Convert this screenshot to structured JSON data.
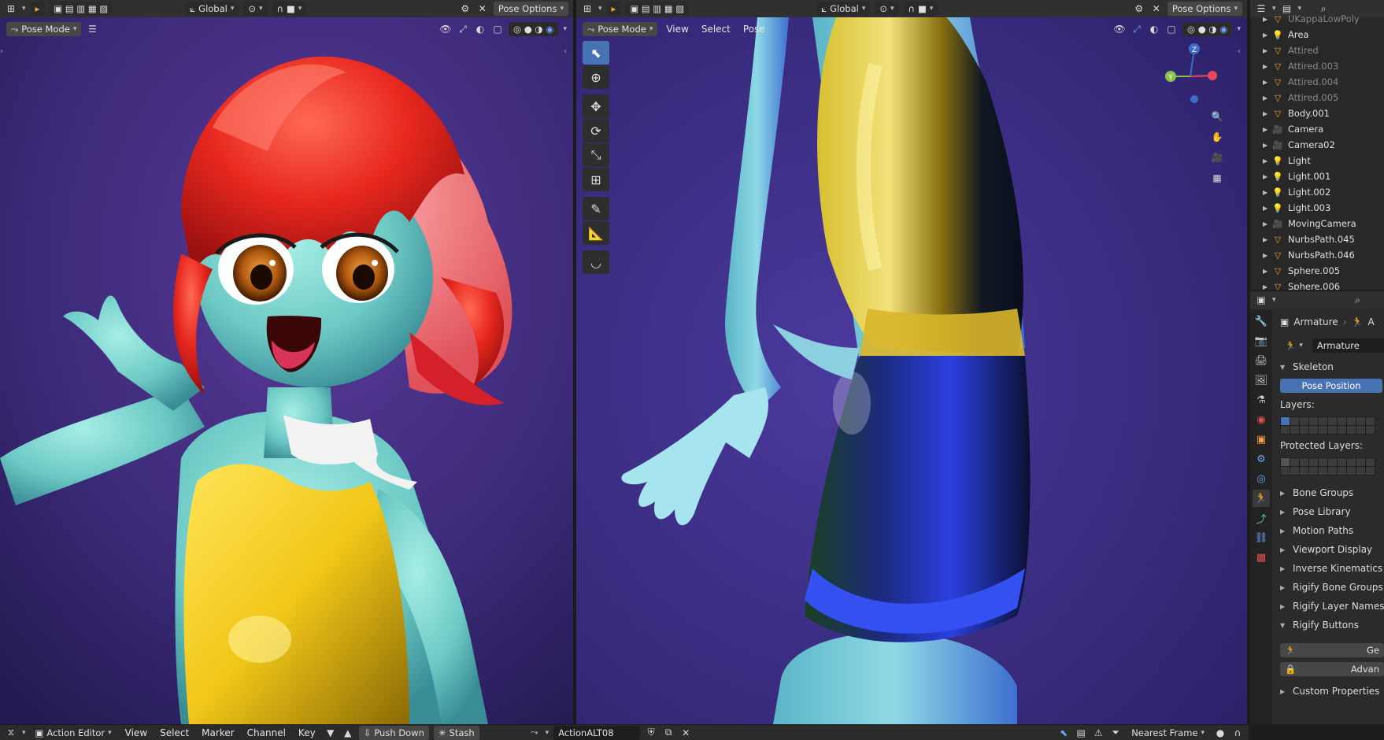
{
  "left_view": {
    "orientation": "Global",
    "pose_options": "Pose Options",
    "mode": "Pose Mode"
  },
  "right_view": {
    "orientation": "Global",
    "pose_options": "Pose Options",
    "mode": "Pose Mode",
    "menus": [
      "View",
      "Select",
      "Pose"
    ],
    "gizmo": {
      "z": "Z",
      "y": "Y"
    }
  },
  "outliner": {
    "items": [
      {
        "label": "UKappaLowPoly",
        "icon": "mesh-icon",
        "dim": true
      },
      {
        "label": "Area",
        "icon": "light-icon",
        "dim": false
      },
      {
        "label": "Attired",
        "icon": "mesh-icon",
        "dim": true
      },
      {
        "label": "Attired.003",
        "icon": "mesh-icon",
        "dim": true
      },
      {
        "label": "Attired.004",
        "icon": "mesh-icon",
        "dim": true
      },
      {
        "label": "Attired.005",
        "icon": "mesh-icon",
        "dim": true
      },
      {
        "label": "Body.001",
        "icon": "mesh-icon",
        "dim": false
      },
      {
        "label": "Camera",
        "icon": "camera-icon",
        "dim": false
      },
      {
        "label": "Camera02",
        "icon": "camera-icon",
        "dim": false
      },
      {
        "label": "Light",
        "icon": "light-icon",
        "dim": false
      },
      {
        "label": "Light.001",
        "icon": "light-icon",
        "dim": false
      },
      {
        "label": "Light.002",
        "icon": "light-icon",
        "dim": false
      },
      {
        "label": "Light.003",
        "icon": "light-icon",
        "dim": false
      },
      {
        "label": "MovingCamera",
        "icon": "camera-icon",
        "dim": false
      },
      {
        "label": "NurbsPath.045",
        "icon": "mesh-icon",
        "dim": false
      },
      {
        "label": "NurbsPath.046",
        "icon": "mesh-icon",
        "dim": false
      },
      {
        "label": "Sphere.005",
        "icon": "mesh-icon",
        "dim": false
      },
      {
        "label": "Sphere.006",
        "icon": "mesh-icon",
        "dim": false
      }
    ]
  },
  "properties": {
    "breadcrumb": "Armature",
    "breadcrumb_more": "A",
    "datablock": "Armature",
    "skeleton_label": "Skeleton",
    "pose_position": "Pose Position",
    "layers_label": "Layers:",
    "protected_label": "Protected Layers:",
    "panels": [
      "Bone Groups",
      "Pose Library",
      "Motion Paths",
      "Viewport Display",
      "Inverse Kinematics",
      "Rigify Bone Groups",
      "Rigify Layer Names"
    ],
    "rigify_buttons": "Rigify Buttons",
    "btn_generate": "Ge",
    "btn_advanced": "Advan",
    "custom_properties": "Custom Properties"
  },
  "timeline": {
    "editor": "Action Editor",
    "menus": [
      "View",
      "Select",
      "Marker",
      "Channel",
      "Key"
    ],
    "push_down": "Push Down",
    "stash": "Stash",
    "action": "ActionALT08",
    "interpolation": "Nearest Frame"
  },
  "colors": {
    "accent": "#4772b3",
    "viewport_bg": "#3c2a78",
    "skin": "#7fd3cf",
    "hair": "#e8281e",
    "top": "#f1c718",
    "skirt_blue": "#2c3fe0"
  }
}
